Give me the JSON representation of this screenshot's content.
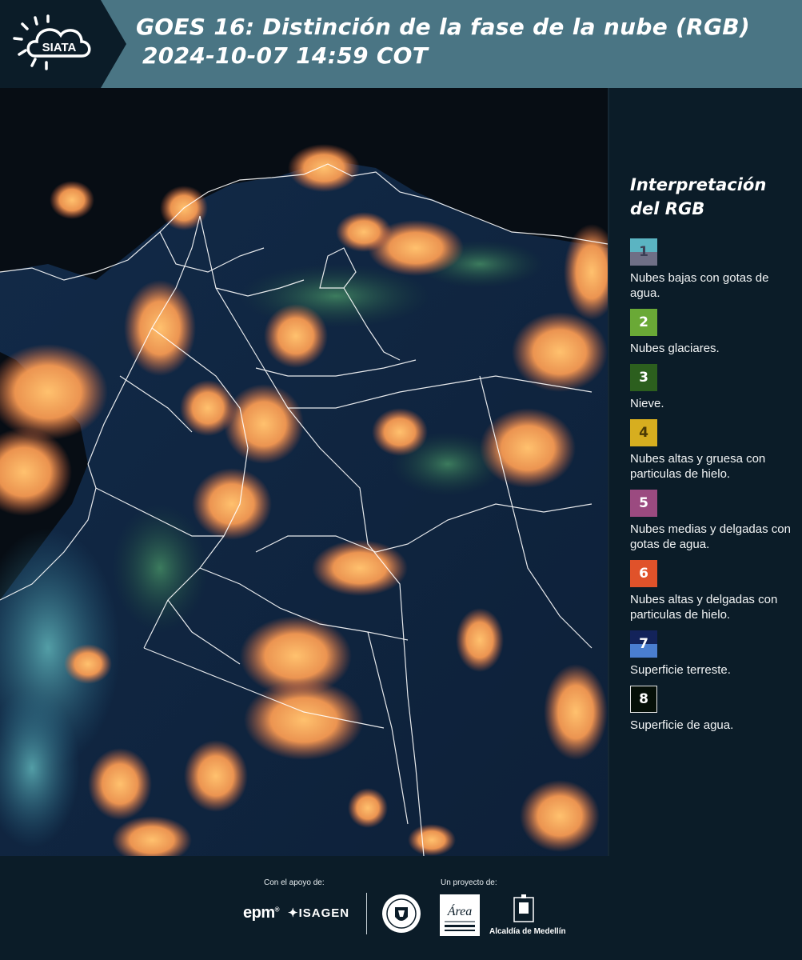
{
  "header": {
    "title_line1": "GOES 16: Distinción de la fase de la nube (RGB)",
    "title_line2": "2024-10-07 14:59 COT",
    "logo_text": "SIATA",
    "background_color": "#4a7584"
  },
  "legend": {
    "title_line1": "Interpretación",
    "title_line2": "del RGB",
    "items": [
      {
        "number": "1",
        "label": "Nubes bajas con gotas de agua.",
        "colors": [
          "#5bb4c2",
          "#6f6f86"
        ]
      },
      {
        "number": "2",
        "label": "Nubes glaciares.",
        "colors": [
          "#6aa936"
        ]
      },
      {
        "number": "3",
        "label": "Nieve.",
        "colors": [
          "#2c5f1e"
        ]
      },
      {
        "number": "4",
        "label": "Nubes altas y gruesa con particulas de hielo.",
        "colors": [
          "#d7ae1f"
        ]
      },
      {
        "number": "5",
        "label": "Nubes medias y delgadas con gotas de agua.",
        "colors": [
          "#9b4a80"
        ]
      },
      {
        "number": "6",
        "label": "Nubes altas y delgadas con particulas de hielo.",
        "colors": [
          "#e0522a"
        ]
      },
      {
        "number": "7",
        "label": "Superficie terreste.",
        "colors": [
          "#13235a",
          "#4a7ed0"
        ]
      },
      {
        "number": "8",
        "label": "Superficie de agua.",
        "colors": [
          "#050f08"
        ]
      }
    ]
  },
  "footer": {
    "support_label": "Con el apoyo de:",
    "project_label": "Un proyecto de:",
    "sponsor_epm": "epm",
    "sponsor_isagen": "ISAGEN",
    "alcaldia": "Alcaldía de Medellín",
    "amva_text": "Área"
  },
  "map": {
    "description_colors": {
      "cloud_high": "#ffb060",
      "land": "#0f2440",
      "water": "#050a10",
      "borders": "#ffffff"
    }
  }
}
